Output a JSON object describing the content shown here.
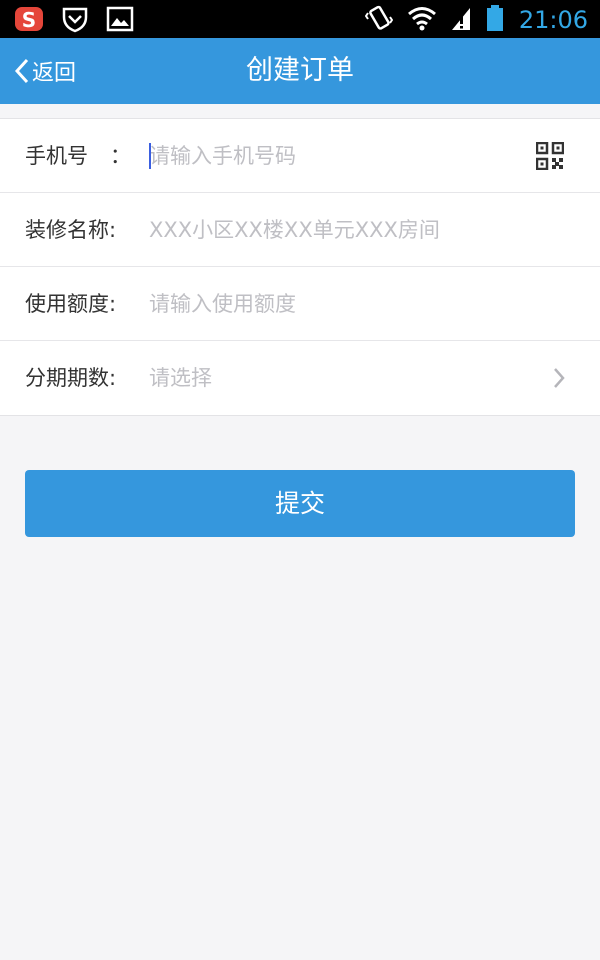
{
  "status_bar": {
    "time": "21:06",
    "icons": [
      "sogou-s-icon",
      "shield-icon",
      "image-icon",
      "vibrate-icon",
      "wifi-icon",
      "signal-alert-icon",
      "battery-icon"
    ]
  },
  "nav": {
    "back_label": "返回",
    "title": "创建订单"
  },
  "form": {
    "rows": [
      {
        "label": "手机号",
        "colon": "：",
        "placeholder": "请输入手机号码",
        "value": ""
      },
      {
        "label": "装修名称:",
        "placeholder": "XXX小区XX楼XX单元XXX房间",
        "value": ""
      },
      {
        "label": "使用额度:",
        "placeholder": "请输入使用额度",
        "value": ""
      },
      {
        "label": "分期期数:",
        "placeholder": "请选择",
        "value": ""
      }
    ]
  },
  "submit_label": "提交",
  "colors": {
    "primary": "#3597dd",
    "status_time": "#33a8e6",
    "background": "#f5f5f7",
    "placeholder": "#bfbfc4"
  }
}
